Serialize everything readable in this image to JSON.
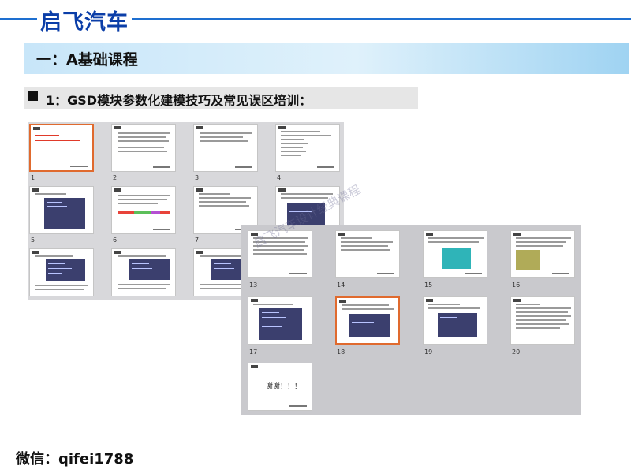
{
  "brand": {
    "title": "启飞汽车"
  },
  "course": {
    "title": "一：A基础课程"
  },
  "section": {
    "title": "1：GSD模块参数化建模技巧及常见误区培训："
  },
  "grid": {
    "thanks_text": "谢谢！！！",
    "watermark": "启飞汽车设计经典课程",
    "slides": [
      {
        "num": "1"
      },
      {
        "num": "2"
      },
      {
        "num": "3"
      },
      {
        "num": "4"
      },
      {
        "num": "5"
      },
      {
        "num": "6"
      },
      {
        "num": "7"
      },
      {
        "num": "13"
      },
      {
        "num": "14"
      },
      {
        "num": "15"
      },
      {
        "num": "16"
      },
      {
        "num": "17"
      },
      {
        "num": "18"
      },
      {
        "num": "19"
      },
      {
        "num": "20"
      }
    ]
  },
  "contact": {
    "wechat": "微信：qifei1788"
  },
  "colors": {
    "brand_blue": "#0b3ea8",
    "selected_border": "#e06a2e",
    "screen": "#3b3f6e"
  }
}
